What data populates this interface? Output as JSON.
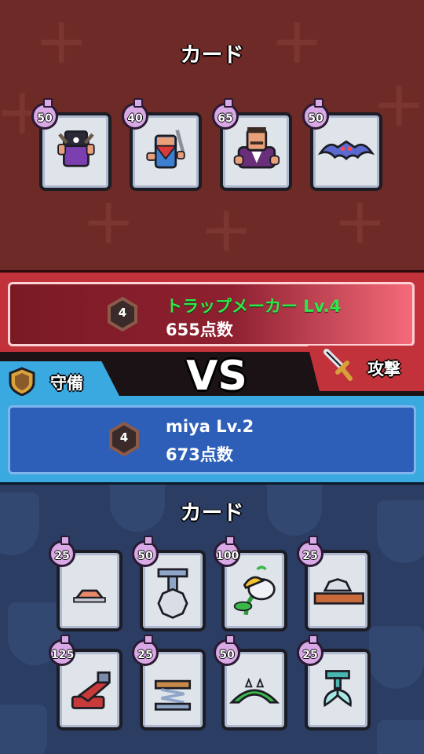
{
  "attacker_section": {
    "title": "カード",
    "cards": [
      {
        "cost": "50",
        "icon": "pirate-character-icon"
      },
      {
        "cost": "40",
        "icon": "bandit-character-icon"
      },
      {
        "cost": "65",
        "icon": "boss-character-icon"
      },
      {
        "cost": "50",
        "icon": "bat-character-icon"
      }
    ]
  },
  "opponent": {
    "level_badge": "4",
    "name": "トラップメーカー Lv.4",
    "score": "655点数",
    "name_color": "#2ee84a"
  },
  "versus": {
    "vs_label": "VS",
    "attack_label": "攻撃",
    "defense_label": "守備"
  },
  "player": {
    "level_badge": "4",
    "name": "miya Lv.2",
    "score": "673点数"
  },
  "defender_section": {
    "title": "カード",
    "cards": [
      {
        "cost": "25",
        "icon": "pressure-plate-trap-icon"
      },
      {
        "cost": "50",
        "icon": "saw-drop-trap-icon"
      },
      {
        "cost": "100",
        "icon": "plant-trap-icon"
      },
      {
        "cost": "25",
        "icon": "floor-saw-trap-icon"
      },
      {
        "cost": "125",
        "icon": "cannon-trap-icon"
      },
      {
        "cost": "25",
        "icon": "spring-trap-icon"
      },
      {
        "cost": "50",
        "icon": "spike-arch-trap-icon"
      },
      {
        "cost": "25",
        "icon": "fan-blade-trap-icon"
      }
    ]
  },
  "colors": {
    "attacker_bg": "#6e2a26",
    "defender_bg": "#2b3d63",
    "cost_badge": "#d9a9e6"
  }
}
